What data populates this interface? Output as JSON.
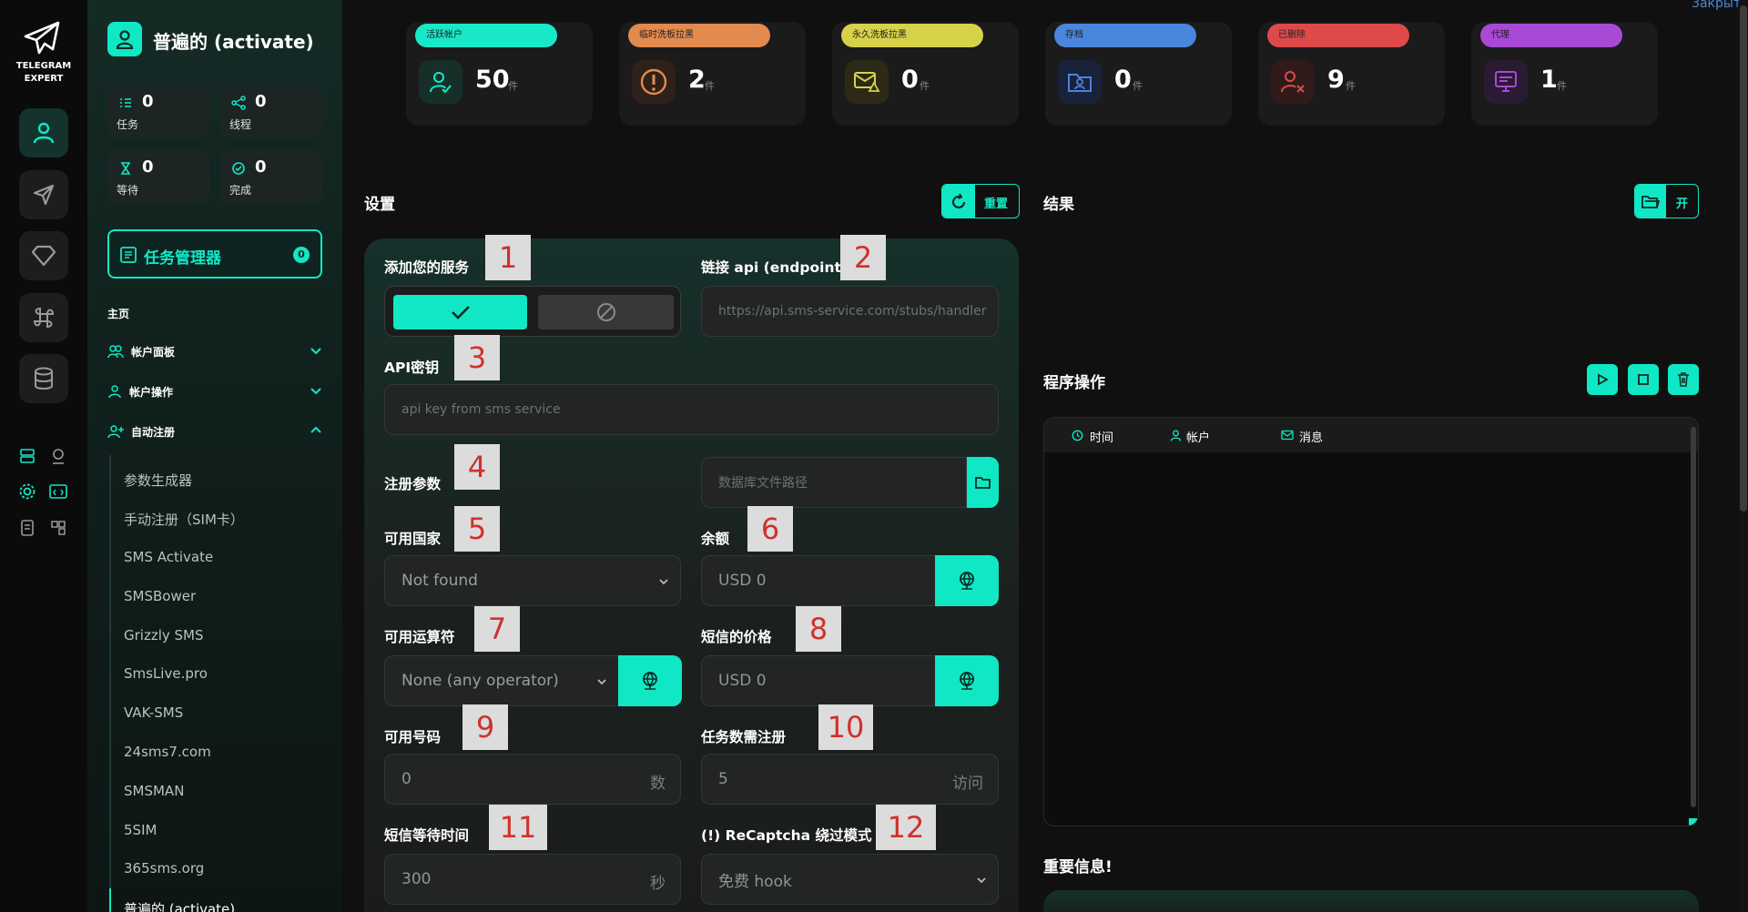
{
  "colors": {
    "accent": "#10e8c5",
    "panel": "#1b1b1b",
    "sidebar": "#142a25"
  },
  "app": {
    "logo_line1": "TELEGRAM",
    "logo_line2": "EXPERT",
    "corner_link": "Закрыть"
  },
  "sidebar": {
    "title": "普遍的 (activate)",
    "stats": [
      {
        "value": "0",
        "label": "任务"
      },
      {
        "value": "0",
        "label": "线程"
      },
      {
        "value": "0",
        "label": "等待"
      },
      {
        "value": "0",
        "label": "完成"
      }
    ],
    "task_manager": {
      "label": "任务管理器",
      "count": "0"
    },
    "home_label": "主页",
    "sections": [
      {
        "label": "帐户面板",
        "expanded": false
      },
      {
        "label": "帐户操作",
        "expanded": false
      },
      {
        "label": "自动注册",
        "expanded": true
      }
    ],
    "sub_items": [
      "参数生成器",
      "手动注册（SIM卡）",
      "SMS Activate",
      "SMSBower",
      "Grizzly SMS",
      "SmsLive.pro",
      "VAK-SMS",
      "24sms7.com",
      "SMSMAN",
      "5SIM",
      "365sms.org",
      "普遍的 (activate)"
    ]
  },
  "cards": [
    {
      "pill": "活跃帐户",
      "value": "50",
      "unit": "件",
      "color": "#18e8c8",
      "icon": "user-check-icon"
    },
    {
      "pill": "临时洗板拉黑",
      "value": "2",
      "unit": "件",
      "color": "#e38a4f",
      "icon": "alert-circle-icon"
    },
    {
      "pill": "永久洗板拉黑",
      "value": "0",
      "unit": "件",
      "color": "#d6d24a",
      "icon": "mail-warning-icon"
    },
    {
      "pill": "存档",
      "value": "0",
      "unit": "件",
      "color": "#4a86dc",
      "icon": "folder-user-icon"
    },
    {
      "pill": "已删除",
      "value": "9",
      "unit": "件",
      "color": "#de4a4a",
      "icon": "user-x-icon"
    },
    {
      "pill": "代理",
      "value": "1",
      "unit": "件",
      "color": "#a84ad6",
      "icon": "proxy-icon"
    }
  ],
  "settings": {
    "header": "设置",
    "reset_label": "重置",
    "add_service_label": "添加您的服务",
    "endpoint_label": "链接 api (endpoint)",
    "endpoint_placeholder": "https://api.sms-service.com/stubs/handler",
    "apikey_label": "API密钥",
    "apikey_placeholder": "api key from sms service",
    "reg_params_label": "注册参数",
    "db_path_placeholder": "数据库文件路径",
    "countries_label": "可用国家",
    "countries_value": "Not found",
    "balance_label": "余额",
    "balance_value": "USD  0",
    "operators_label": "可用运算符",
    "operators_value": "None (any operator)",
    "sms_price_label": "短信的价格",
    "sms_price_value": "USD  0",
    "numbers_label": "可用号码",
    "numbers_value": "0",
    "numbers_suffix": "数",
    "tasks_label": "任务数需注册",
    "tasks_value": "5",
    "tasks_suffix": "访问",
    "sms_wait_label": "短信等待时间",
    "sms_wait_value": "300",
    "sms_wait_suffix": "秒",
    "recaptcha_label": "(!) ReCaptcha 绕过模式",
    "recaptcha_value": "免费 hook"
  },
  "badges": [
    "1",
    "2",
    "3",
    "4",
    "5",
    "6",
    "7",
    "8",
    "9",
    "10",
    "11",
    "12"
  ],
  "results": {
    "header": "结果",
    "open_label": "开"
  },
  "program": {
    "header": "程序操作",
    "columns": [
      "时间",
      "帐户",
      "消息"
    ]
  },
  "important": {
    "header": "重要信息!"
  }
}
